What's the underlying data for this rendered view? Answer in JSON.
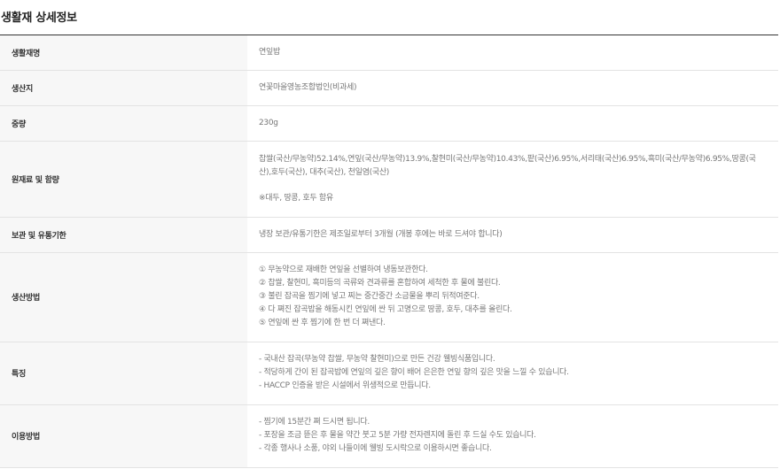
{
  "section_title": "생활재 상세정보",
  "rows": [
    {
      "label": "생활재명",
      "value": "연잎밥"
    },
    {
      "label": "생산지",
      "value": "연꽃마을영농조합법인(비과세)"
    },
    {
      "label": "중량",
      "value": "230g"
    },
    {
      "label": "원재료 및 함량",
      "value": "찹쌀(국산/무농약)52.14%,연잎(국산/무농약)13.9%,찰현미(국산/무농약)10.43%,팥(국산)6.95%,서리태(국산)6.95%,흑미(국산/무농약)6.95%,땅콩(국산),호두(국산), 대추(국산), 천일염(국산)",
      "note": "※대두, 땅콩, 호두 함유"
    },
    {
      "label": "보관 및 유통기한",
      "value": "냉장 보관/유통기한은 제조일로부터 3개월 (개봉 후에는 바로 드셔야 합니다)"
    },
    {
      "label": "생산방법",
      "lines": [
        "① 무농약으로 재배한 연잎을 선별하여 냉동보관한다.",
        "② 찹쌀, 찰현미, 흑미등의 곡류와 견과류를 혼합하여 세척한 후 물에 불린다.",
        "③ 불린 잡곡을 찜기에 넣고 찌는 중간중간 소금물을 뿌리 뒤적여준다.",
        "④ 다 쪄진 잡곡밥을 해동시킨 연잎에 싼 뒤 고명으로 땅콩, 호두, 대추를 올린다.",
        "⑤ 연잎에 싼 후 찜기에 한 번 더 쪄낸다."
      ]
    },
    {
      "label": "특징",
      "lines": [
        "- 국내산 잡곡(무농약 찹쌀, 무농약 찰현미)으로 만든 건강 웰빙식품입니다.",
        "- 적당하게 간이 된 잡곡밥에 연잎의 깊은 향이 배어 은은한 연잎 향의 깊은 맛을 느낄 수 있습니다.",
        "- HACCP 인증을 받은 시설에서 위생적으로 만듭니다."
      ]
    },
    {
      "label": "이용방법",
      "lines": [
        "- 찜기에 15분간 쪄 드시면 됩니다.",
        "- 포장을 조금 뜯은 후 물을 약간 붓고 5분 가량 전자렌지에 돌린 후 드실 수도 있습니다.",
        "- 각종 행사나 소풍, 야외 나들이에 웰빙 도시락으로 이용하시면 좋습니다."
      ]
    }
  ]
}
